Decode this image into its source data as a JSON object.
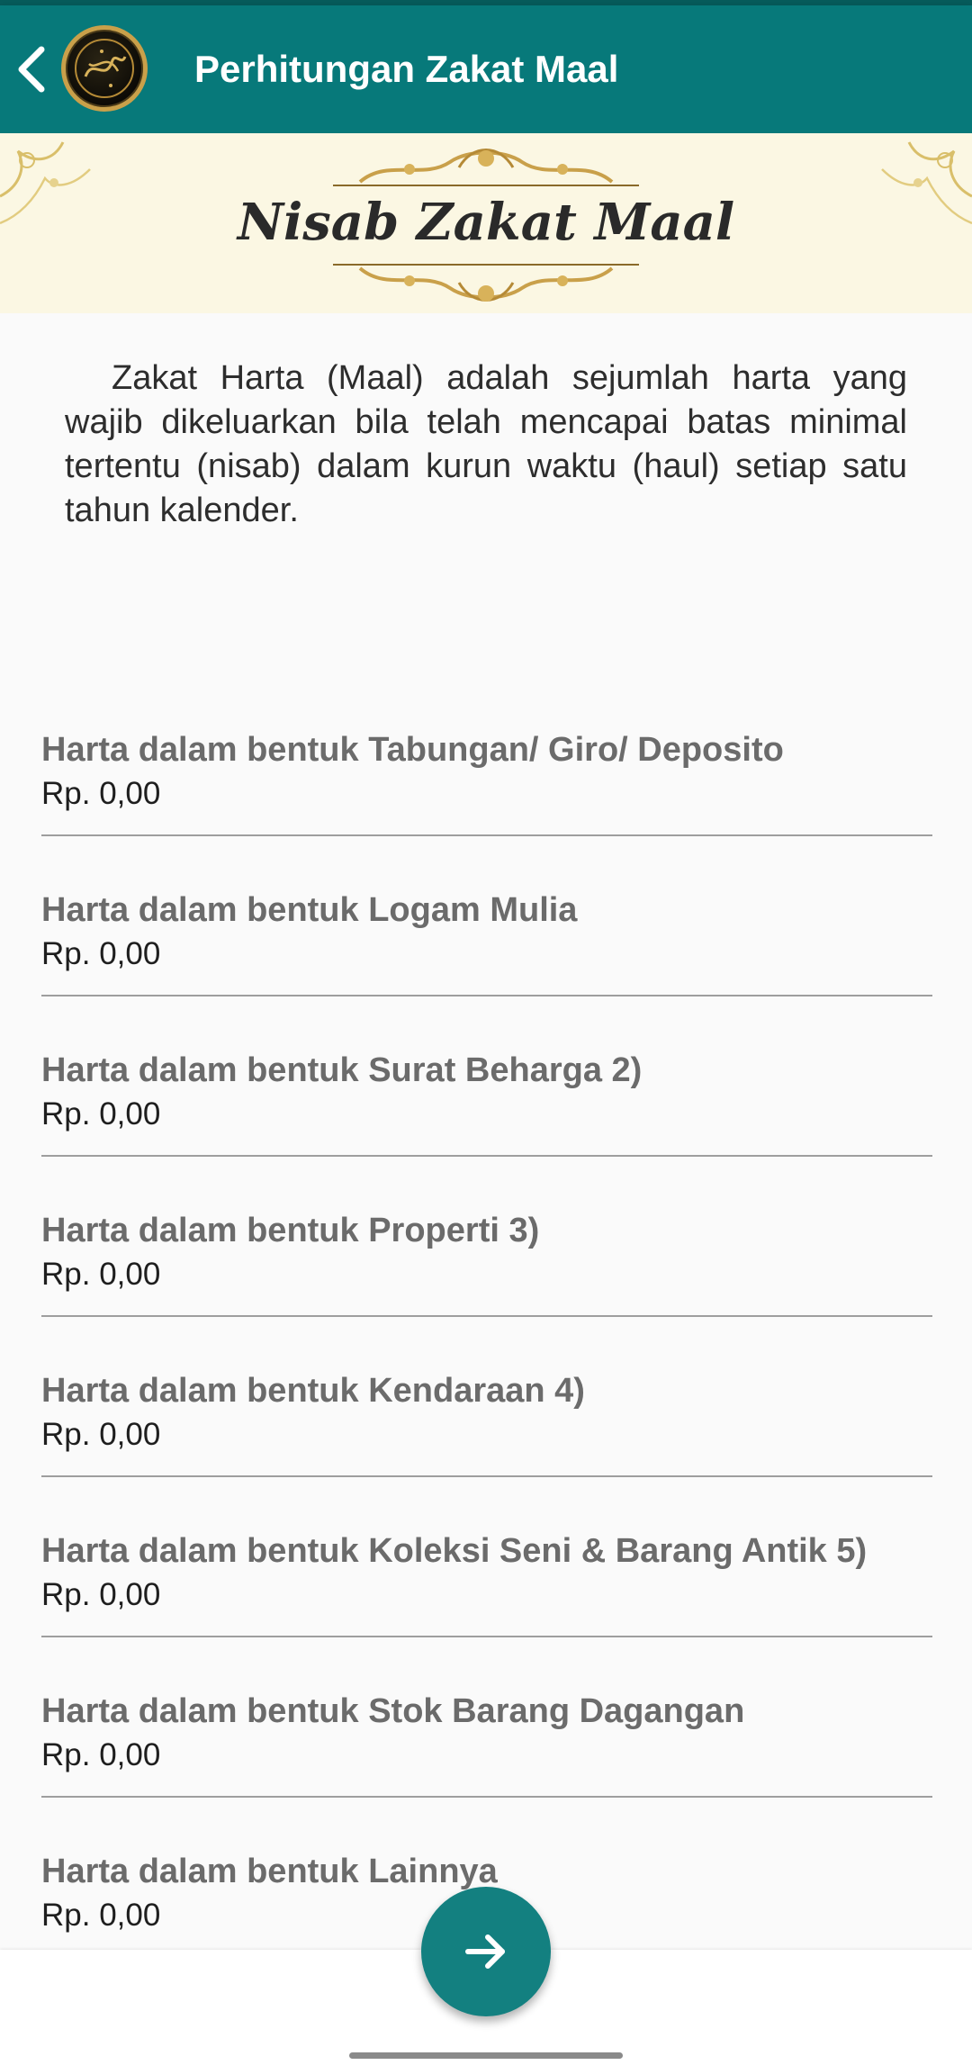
{
  "appbar": {
    "title": "Perhitungan Zakat Maal",
    "back_icon": "back-arrow-icon",
    "logo_icon": "quran-logo-icon"
  },
  "banner": {
    "title": "Nisab Zakat Maal"
  },
  "description": "Zakat Harta (Maal) adalah sejumlah harta yang wajib dikeluarkan bila telah mencapai batas minimal tertentu (nisab) dalam kurun waktu (haul) setiap satu tahun kalender.",
  "fields": [
    {
      "label": "Harta dalam bentuk Tabungan/ Giro/ Deposito",
      "value": "Rp. 0,00"
    },
    {
      "label": "Harta dalam bentuk Logam Mulia",
      "value": "Rp. 0,00"
    },
    {
      "label": "Harta dalam bentuk Surat Beharga 2)",
      "value": "Rp. 0,00"
    },
    {
      "label": "Harta dalam bentuk Properti 3)",
      "value": "Rp. 0,00"
    },
    {
      "label": "Harta dalam bentuk Kendaraan 4)",
      "value": "Rp. 0,00"
    },
    {
      "label": "Harta dalam bentuk Koleksi Seni & Barang Antik 5)",
      "value": "Rp. 0,00"
    },
    {
      "label": "Harta dalam bentuk Stok Barang Dagangan",
      "value": "Rp. 0,00"
    },
    {
      "label": "Harta dalam bentuk Lainnya",
      "value": "Rp. 0,00"
    }
  ],
  "fab": {
    "icon": "arrow-right-icon"
  },
  "colors": {
    "primary": "#07797a",
    "fab": "#138080",
    "banner_bg": "#fbf7e3",
    "gold": "#c9a04a"
  }
}
